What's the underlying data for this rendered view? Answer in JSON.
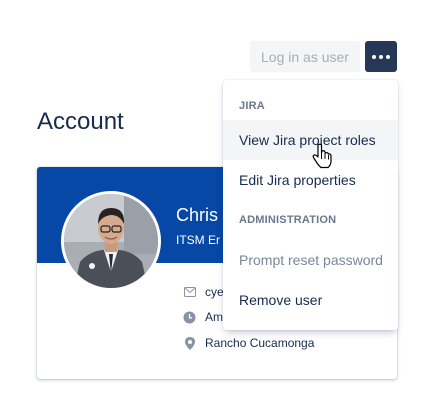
{
  "header": {
    "login_label": "Log in as user",
    "more_icon": "ellipsis-icon"
  },
  "page": {
    "title": "Account"
  },
  "profile": {
    "name": "Chris Y",
    "title": "ITSM Er",
    "email": "cye",
    "timezone": "Am",
    "location": "Rancho Cucamonga",
    "banner_color": "#0747a6"
  },
  "menu": {
    "groups": [
      {
        "heading": "JIRA",
        "items": [
          {
            "label": "View Jira project roles"
          },
          {
            "label": "Edit Jira properties"
          }
        ]
      },
      {
        "heading": "ADMINISTRATION",
        "items": [
          {
            "label": "Prompt reset password"
          },
          {
            "label": "Remove user"
          }
        ]
      }
    ]
  },
  "colors": {
    "accent": "#253858",
    "text": "#172b4d",
    "muted": "#6b778c",
    "disabled": "#7a869a"
  }
}
